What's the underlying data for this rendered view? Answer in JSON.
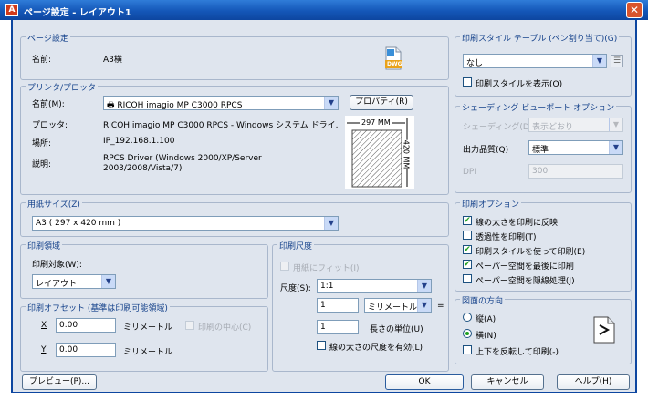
{
  "window": {
    "title": "ページ設定 - レイアウト1",
    "app_icon": "autocad-icon",
    "close_icon": "close-icon"
  },
  "page_setup": {
    "legend": "ページ設定",
    "name_label": "名前:",
    "name_value": "A3横",
    "dwg_icon": "dwg-file-icon",
    "dwg_text": "DWG"
  },
  "printer": {
    "legend": "プリンタ/プロッタ",
    "name_label": "名前(M):",
    "name_value": "RICOH imagio MP C3000 RPCS",
    "properties_button": "プロパティ(R)",
    "plotter_label": "プロッタ:",
    "plotter_value": "RICOH imagio MP C3000 RPCS - Windows システム ドライ...",
    "location_label": "場所:",
    "location_value": "IP_192.168.1.100",
    "description_label": "説明:",
    "description_value": "RPCS Driver (Windows 2000/XP/Server 2003/2008/Vista/7)",
    "preview_width": "297 MM",
    "preview_height": "420 MM"
  },
  "paper_size": {
    "legend": "用紙サイズ(Z)",
    "value": "A3 ( 297 x 420 mm )"
  },
  "plot_area": {
    "legend": "印刷領域",
    "target_label": "印刷対象(W):",
    "target_value": "レイアウト"
  },
  "plot_offset": {
    "legend": "印刷オフセット (基準は印刷可能領域)",
    "x_label": "X",
    "x_value": "0.00",
    "x_unit": "ミリメートル",
    "center_label": "印刷の中心(C)",
    "y_label": "Y",
    "y_value": "0.00",
    "y_unit": "ミリメートル"
  },
  "plot_scale": {
    "legend": "印刷尺度",
    "fit_label": "用紙にフィット(I)",
    "scale_label": "尺度(S):",
    "scale_value": "1:1",
    "paper_value": "1",
    "paper_unit": "ミリメートル",
    "equals": "=",
    "units_value": "1",
    "units_label": "長さの単位(U)",
    "lineweights_label": "線の太さの尺度を有効(L)"
  },
  "plot_style": {
    "legend": "印刷スタイル テーブル (ペン割り当て)(G)",
    "value": "なし",
    "edit_icon": "edit-table-icon",
    "display_label": "印刷スタイルを表示(O)"
  },
  "shaded": {
    "legend": "シェーディング ビューポート オプション",
    "shade_label": "シェーディング(D)",
    "shade_value": "表示どおり",
    "quality_label": "出力品質(Q)",
    "quality_value": "標準",
    "dpi_label": "DPI",
    "dpi_value": "300"
  },
  "plot_options": {
    "legend": "印刷オプション",
    "items": [
      {
        "label": "線の太さを印刷に反映",
        "checked": true
      },
      {
        "label": "透過性を印刷(T)",
        "checked": false
      },
      {
        "label": "印刷スタイルを使って印刷(E)",
        "checked": true
      },
      {
        "label": "ペーパー空間を最後に印刷",
        "checked": true
      },
      {
        "label": "ペーパー空間を隠線処理(J)",
        "checked": false
      }
    ]
  },
  "orientation": {
    "legend": "図面の方向",
    "portrait_label": "縦(A)",
    "landscape_label": "横(N)",
    "landscape_selected": true,
    "upside_down_label": "上下を反転して印刷(-)",
    "icon": "landscape-orientation-icon"
  },
  "footer": {
    "preview_button": "プレビュー(P)...",
    "ok_button": "OK",
    "cancel_button": "キャンセル",
    "help_button": "ヘルプ(H)"
  }
}
